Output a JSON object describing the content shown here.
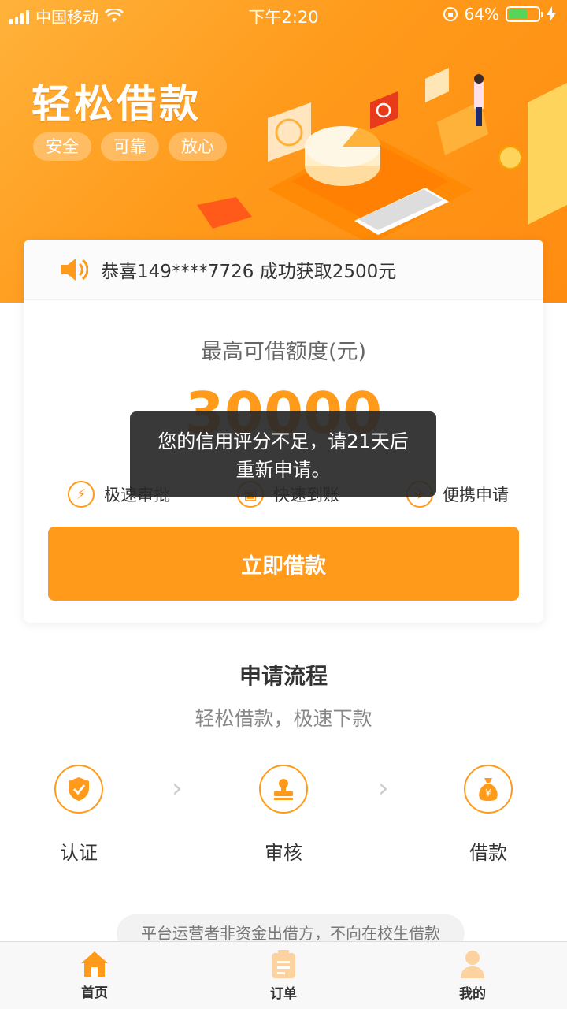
{
  "status_bar": {
    "carrier": "中国移动",
    "time": "下午2:20",
    "battery": "64%"
  },
  "banner": {
    "title": "轻松借款",
    "tags": [
      "安全",
      "可靠",
      "放心"
    ]
  },
  "notice": {
    "text": "恭喜149****7726 成功获取2500元"
  },
  "limit": {
    "label": "最高可借额度(元)",
    "amount": "30000"
  },
  "features": [
    {
      "icon": "lightning-icon",
      "label": "极速审批"
    },
    {
      "icon": "card-icon",
      "label": "快速到账"
    },
    {
      "icon": "phone-icon",
      "label": "便携申请"
    }
  ],
  "borrow_button": "立即借款",
  "toast": {
    "line1": "您的信用评分不足，请21天后",
    "line2": "重新申请。"
  },
  "process": {
    "title": "申请流程",
    "subtitle": "轻松借款，极速下款",
    "steps": [
      {
        "icon": "shield-check-icon",
        "label": "认证"
      },
      {
        "icon": "stamp-icon",
        "label": "审核"
      },
      {
        "icon": "money-bag-icon",
        "label": "借款"
      }
    ]
  },
  "disclaimer": "平台运营者非资金出借方，不向在校生借款",
  "tabbar": [
    {
      "icon": "home-icon",
      "label": "首页",
      "active": true
    },
    {
      "icon": "order-icon",
      "label": "订单",
      "active": false
    },
    {
      "icon": "user-icon",
      "label": "我的",
      "active": false
    }
  ],
  "colors": {
    "accent": "#ff9a1b",
    "toast_bg": "#282828"
  }
}
